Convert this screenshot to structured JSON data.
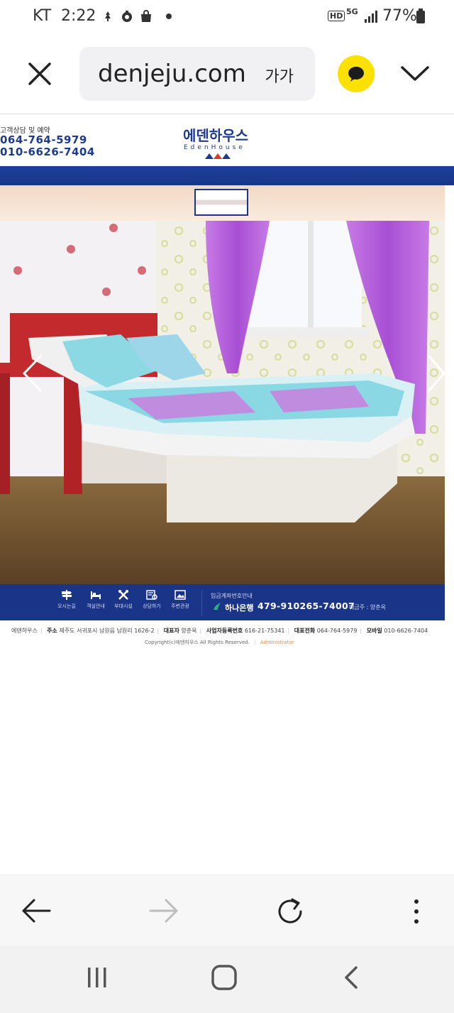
{
  "status": {
    "carrier": "KT",
    "time": "2:22",
    "battery": "77%",
    "hd": "HD",
    "network": "5G"
  },
  "browser": {
    "url": "denjeju.com",
    "text_size_label": "가가"
  },
  "site": {
    "contact_label": "고객상담 및 예약",
    "phone1": "064-764-5979",
    "phone2": "010-6626-7404",
    "logo_ko": "에덴하우스",
    "logo_en": "EdenHouse",
    "nav": [
      {
        "label": "오시는길",
        "icon": "signpost-icon"
      },
      {
        "label": "객실안내",
        "icon": "bed-icon"
      },
      {
        "label": "부대시설",
        "icon": "tools-icon"
      },
      {
        "label": "상담하기",
        "icon": "consult-icon"
      },
      {
        "label": "주변관광",
        "icon": "photo-icon"
      }
    ],
    "bank": {
      "title": "입금계좌번호안내",
      "name": "하나은행",
      "number": "479-910265-74007",
      "owner": "예금주 : 양춘옥"
    },
    "footer": {
      "company": "에덴하우스",
      "addr_label": "주소",
      "addr": "제주도 서귀포시 남원읍 남원리 1626-2",
      "ceo_label": "대표자",
      "ceo": "양춘옥",
      "biz_label": "사업자등록번호",
      "biz": "616-21-75341",
      "tel_label": "대표전화",
      "tel": "064-764-5979",
      "mobile_label": "모바일",
      "mobile": "010-6626-7404",
      "copyright": "Copyright(c)에덴하우스 All Rights Reserved.",
      "admin": "Administrator"
    }
  },
  "colors": {
    "brand_blue": "#1a3588",
    "kakao_yellow": "#fae100",
    "curtain": "#b45ad8"
  }
}
